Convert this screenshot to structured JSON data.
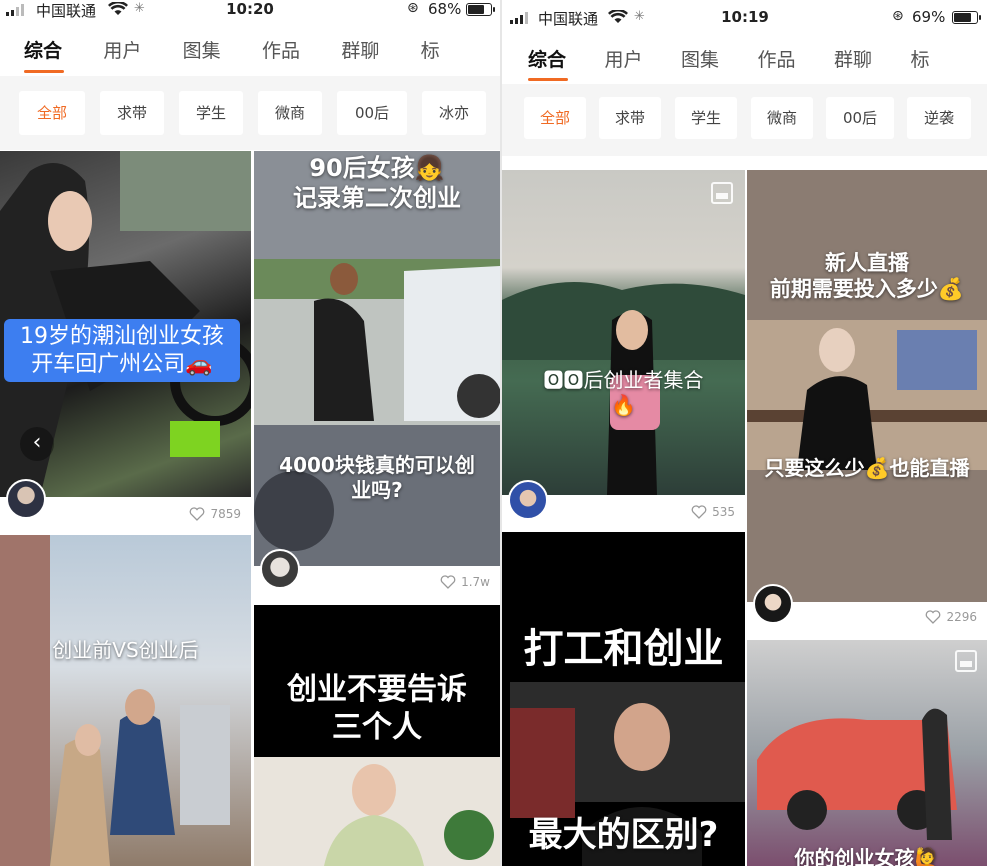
{
  "left": {
    "status": {
      "carrier": "中国联通",
      "time": "10:20",
      "battery": "68%",
      "battery_level": 0.68
    },
    "tabs": [
      "综合",
      "用户",
      "图集",
      "作品",
      "群聊",
      "标"
    ],
    "chips": [
      "全部",
      "求带",
      "学生",
      "微商",
      "00后",
      "冰亦"
    ],
    "cards": {
      "c1": {
        "caption": "19岁的潮汕创业女孩\n开车回广州公司🚗",
        "likes": "7859"
      },
      "c2": {
        "caption_top": "90后女孩👧\n记录第二次创业",
        "caption_mid": "4000块钱真的可以创\n业吗?",
        "likes": "1.7w"
      },
      "c3": {
        "caption": "创业前VS创业后"
      },
      "c4": {
        "caption": "创业不要告诉\n三个人"
      }
    }
  },
  "right": {
    "status": {
      "carrier": "中国联通",
      "time": "10:19",
      "battery": "69%",
      "battery_level": 0.69
    },
    "tabs": [
      "综合",
      "用户",
      "图集",
      "作品",
      "群聊",
      "标"
    ],
    "chips": [
      "全部",
      "求带",
      "学生",
      "微商",
      "00后",
      "逆袭"
    ],
    "cards": {
      "c1": {
        "caption": "🅾🅾后创业者集合\n🔥",
        "likes": "535"
      },
      "c2": {
        "caption_top": "新人直播\n前期需要投入多少💰",
        "caption_bottom": "只要这么少💰也能直播",
        "likes": "2296"
      },
      "c3": {
        "caption_top": "打工和创业",
        "caption_bottom": "最大的区别?"
      },
      "c4": {
        "caption": "你的创业女孩🙋"
      }
    }
  }
}
